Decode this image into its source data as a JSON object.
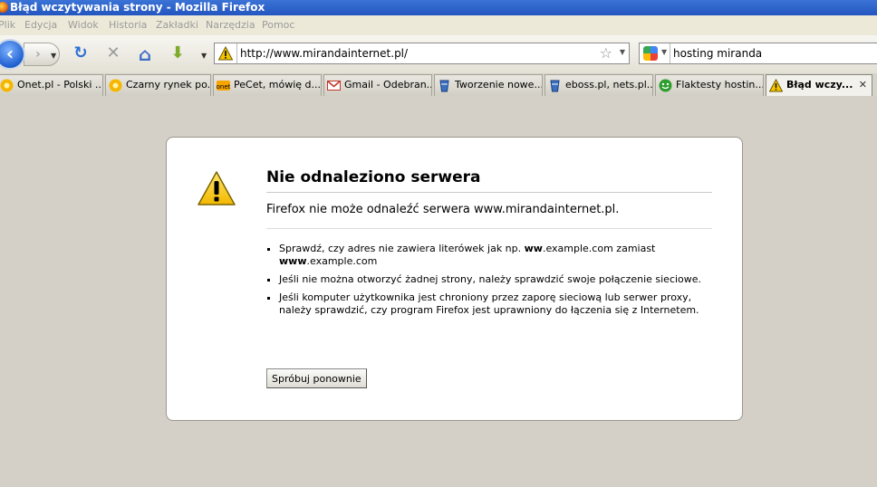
{
  "window": {
    "title": "Błąd wczytywania strony - Mozilla Firefox"
  },
  "menu": [
    "Plik",
    "Edycja",
    "Widok",
    "Historia",
    "Zakładki",
    "Narzędzia",
    "Pomoc"
  ],
  "nav": {
    "url": "http://www.mirandainternet.pl/",
    "search_value": "hosting miranda",
    "back_glyph": "‹",
    "forward_glyph": "›",
    "reload_glyph": "↻",
    "stop_glyph": "✕",
    "home_glyph": "⌂",
    "download_glyph": "⬇",
    "star_glyph": "☆",
    "dropdown_glyph": "▼"
  },
  "tabs": [
    {
      "label": "Onet.pl - Polski ...",
      "icon": "onet-icon",
      "active": false
    },
    {
      "label": "Czarny rynek po...",
      "icon": "onet-icon",
      "active": false
    },
    {
      "label": "PeCet, mówię d...",
      "icon": "onet-badge-icon",
      "active": false
    },
    {
      "label": "Gmail - Odebran...",
      "icon": "gmail-icon",
      "active": false
    },
    {
      "label": "Tworzenie nowe...",
      "icon": "cup-icon",
      "active": false
    },
    {
      "label": "eboss.pl, nets.pl...",
      "icon": "cup-icon",
      "active": false
    },
    {
      "label": "Flaktesty hostin...",
      "icon": "green-smiley-icon",
      "active": false
    },
    {
      "label": "Błąd wczy...",
      "icon": "warning-icon",
      "active": true
    }
  ],
  "tab_close_glyph": "✕",
  "error": {
    "title": "Nie odnaleziono serwera",
    "short_desc": "Firefox nie może odnaleźć serwera www.mirandainternet.pl.",
    "bullets": [
      {
        "before": "Sprawdź, czy adres nie zawiera literówek jak np. ",
        "bold1": "ww",
        "middle": ".example.com zamiast ",
        "bold2": "www",
        "after": ".example.com"
      },
      {
        "text": "Jeśli nie można otworzyć żadnej strony, należy sprawdzić swoje połączenie sieciowe."
      },
      {
        "text": "Jeśli komputer użytkownika jest chroniony przez zaporę sieciową lub serwer proxy, należy sprawdzić, czy program Firefox jest uprawniony do łączenia się z Internetem."
      }
    ],
    "retry_label": "Spróbuj ponownie"
  },
  "colors": {
    "accent": "#2356bf",
    "page_bg": "#d4d0c8",
    "warning_yellow": "#f5c400"
  }
}
